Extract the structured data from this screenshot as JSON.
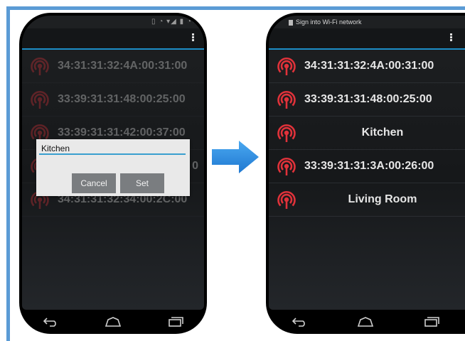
{
  "left_phone": {
    "items": [
      {
        "label": "34:31:31:32:4A:00:31:00"
      },
      {
        "label": "33:39:31:31:48:00:25:00"
      },
      {
        "label": "33:39:31:31:42:00:37:00"
      },
      {
        "label": "0"
      },
      {
        "label": "34:31:31:32:34:00:2C:00"
      }
    ],
    "dialog": {
      "input_value": "Kitchen",
      "cancel_label": "Cancel",
      "set_label": "Set"
    }
  },
  "right_phone": {
    "status_text": "Sign into Wi-Fi network",
    "items": [
      {
        "label": "34:31:31:32:4A:00:31:00"
      },
      {
        "label": "33:39:31:31:48:00:25:00"
      },
      {
        "label": "Kitchen"
      },
      {
        "label": "33:39:31:31:3A:00:26:00"
      },
      {
        "label": "Living Room"
      }
    ]
  },
  "colors": {
    "frame": "#5b9bd5",
    "arrow": "#2f8fe0",
    "wifi_icon": "#e0323a",
    "accent": "#1d8ec7"
  },
  "icons": [
    "wifi-signal-icon",
    "back-icon",
    "home-icon",
    "recents-icon",
    "overflow-menu-icon",
    "arrow-right-icon"
  ]
}
